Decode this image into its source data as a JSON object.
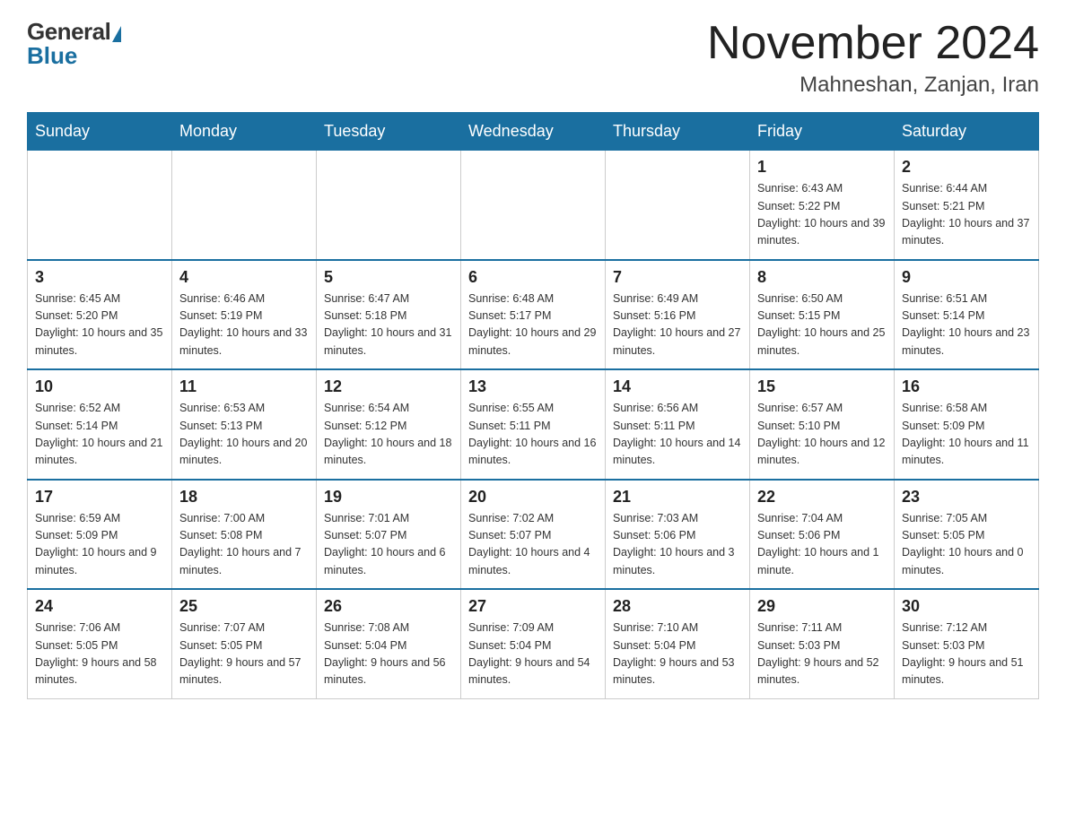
{
  "header": {
    "logo": {
      "general": "General",
      "blue": "Blue"
    },
    "title": "November 2024",
    "location": "Mahneshan, Zanjan, Iran"
  },
  "weekdays": [
    "Sunday",
    "Monday",
    "Tuesday",
    "Wednesday",
    "Thursday",
    "Friday",
    "Saturday"
  ],
  "weeks": [
    [
      {
        "day": "",
        "sunrise": "",
        "sunset": "",
        "daylight": ""
      },
      {
        "day": "",
        "sunrise": "",
        "sunset": "",
        "daylight": ""
      },
      {
        "day": "",
        "sunrise": "",
        "sunset": "",
        "daylight": ""
      },
      {
        "day": "",
        "sunrise": "",
        "sunset": "",
        "daylight": ""
      },
      {
        "day": "",
        "sunrise": "",
        "sunset": "",
        "daylight": ""
      },
      {
        "day": "1",
        "sunrise": "Sunrise: 6:43 AM",
        "sunset": "Sunset: 5:22 PM",
        "daylight": "Daylight: 10 hours and 39 minutes."
      },
      {
        "day": "2",
        "sunrise": "Sunrise: 6:44 AM",
        "sunset": "Sunset: 5:21 PM",
        "daylight": "Daylight: 10 hours and 37 minutes."
      }
    ],
    [
      {
        "day": "3",
        "sunrise": "Sunrise: 6:45 AM",
        "sunset": "Sunset: 5:20 PM",
        "daylight": "Daylight: 10 hours and 35 minutes."
      },
      {
        "day": "4",
        "sunrise": "Sunrise: 6:46 AM",
        "sunset": "Sunset: 5:19 PM",
        "daylight": "Daylight: 10 hours and 33 minutes."
      },
      {
        "day": "5",
        "sunrise": "Sunrise: 6:47 AM",
        "sunset": "Sunset: 5:18 PM",
        "daylight": "Daylight: 10 hours and 31 minutes."
      },
      {
        "day": "6",
        "sunrise": "Sunrise: 6:48 AM",
        "sunset": "Sunset: 5:17 PM",
        "daylight": "Daylight: 10 hours and 29 minutes."
      },
      {
        "day": "7",
        "sunrise": "Sunrise: 6:49 AM",
        "sunset": "Sunset: 5:16 PM",
        "daylight": "Daylight: 10 hours and 27 minutes."
      },
      {
        "day": "8",
        "sunrise": "Sunrise: 6:50 AM",
        "sunset": "Sunset: 5:15 PM",
        "daylight": "Daylight: 10 hours and 25 minutes."
      },
      {
        "day": "9",
        "sunrise": "Sunrise: 6:51 AM",
        "sunset": "Sunset: 5:14 PM",
        "daylight": "Daylight: 10 hours and 23 minutes."
      }
    ],
    [
      {
        "day": "10",
        "sunrise": "Sunrise: 6:52 AM",
        "sunset": "Sunset: 5:14 PM",
        "daylight": "Daylight: 10 hours and 21 minutes."
      },
      {
        "day": "11",
        "sunrise": "Sunrise: 6:53 AM",
        "sunset": "Sunset: 5:13 PM",
        "daylight": "Daylight: 10 hours and 20 minutes."
      },
      {
        "day": "12",
        "sunrise": "Sunrise: 6:54 AM",
        "sunset": "Sunset: 5:12 PM",
        "daylight": "Daylight: 10 hours and 18 minutes."
      },
      {
        "day": "13",
        "sunrise": "Sunrise: 6:55 AM",
        "sunset": "Sunset: 5:11 PM",
        "daylight": "Daylight: 10 hours and 16 minutes."
      },
      {
        "day": "14",
        "sunrise": "Sunrise: 6:56 AM",
        "sunset": "Sunset: 5:11 PM",
        "daylight": "Daylight: 10 hours and 14 minutes."
      },
      {
        "day": "15",
        "sunrise": "Sunrise: 6:57 AM",
        "sunset": "Sunset: 5:10 PM",
        "daylight": "Daylight: 10 hours and 12 minutes."
      },
      {
        "day": "16",
        "sunrise": "Sunrise: 6:58 AM",
        "sunset": "Sunset: 5:09 PM",
        "daylight": "Daylight: 10 hours and 11 minutes."
      }
    ],
    [
      {
        "day": "17",
        "sunrise": "Sunrise: 6:59 AM",
        "sunset": "Sunset: 5:09 PM",
        "daylight": "Daylight: 10 hours and 9 minutes."
      },
      {
        "day": "18",
        "sunrise": "Sunrise: 7:00 AM",
        "sunset": "Sunset: 5:08 PM",
        "daylight": "Daylight: 10 hours and 7 minutes."
      },
      {
        "day": "19",
        "sunrise": "Sunrise: 7:01 AM",
        "sunset": "Sunset: 5:07 PM",
        "daylight": "Daylight: 10 hours and 6 minutes."
      },
      {
        "day": "20",
        "sunrise": "Sunrise: 7:02 AM",
        "sunset": "Sunset: 5:07 PM",
        "daylight": "Daylight: 10 hours and 4 minutes."
      },
      {
        "day": "21",
        "sunrise": "Sunrise: 7:03 AM",
        "sunset": "Sunset: 5:06 PM",
        "daylight": "Daylight: 10 hours and 3 minutes."
      },
      {
        "day": "22",
        "sunrise": "Sunrise: 7:04 AM",
        "sunset": "Sunset: 5:06 PM",
        "daylight": "Daylight: 10 hours and 1 minute."
      },
      {
        "day": "23",
        "sunrise": "Sunrise: 7:05 AM",
        "sunset": "Sunset: 5:05 PM",
        "daylight": "Daylight: 10 hours and 0 minutes."
      }
    ],
    [
      {
        "day": "24",
        "sunrise": "Sunrise: 7:06 AM",
        "sunset": "Sunset: 5:05 PM",
        "daylight": "Daylight: 9 hours and 58 minutes."
      },
      {
        "day": "25",
        "sunrise": "Sunrise: 7:07 AM",
        "sunset": "Sunset: 5:05 PM",
        "daylight": "Daylight: 9 hours and 57 minutes."
      },
      {
        "day": "26",
        "sunrise": "Sunrise: 7:08 AM",
        "sunset": "Sunset: 5:04 PM",
        "daylight": "Daylight: 9 hours and 56 minutes."
      },
      {
        "day": "27",
        "sunrise": "Sunrise: 7:09 AM",
        "sunset": "Sunset: 5:04 PM",
        "daylight": "Daylight: 9 hours and 54 minutes."
      },
      {
        "day": "28",
        "sunrise": "Sunrise: 7:10 AM",
        "sunset": "Sunset: 5:04 PM",
        "daylight": "Daylight: 9 hours and 53 minutes."
      },
      {
        "day": "29",
        "sunrise": "Sunrise: 7:11 AM",
        "sunset": "Sunset: 5:03 PM",
        "daylight": "Daylight: 9 hours and 52 minutes."
      },
      {
        "day": "30",
        "sunrise": "Sunrise: 7:12 AM",
        "sunset": "Sunset: 5:03 PM",
        "daylight": "Daylight: 9 hours and 51 minutes."
      }
    ]
  ]
}
